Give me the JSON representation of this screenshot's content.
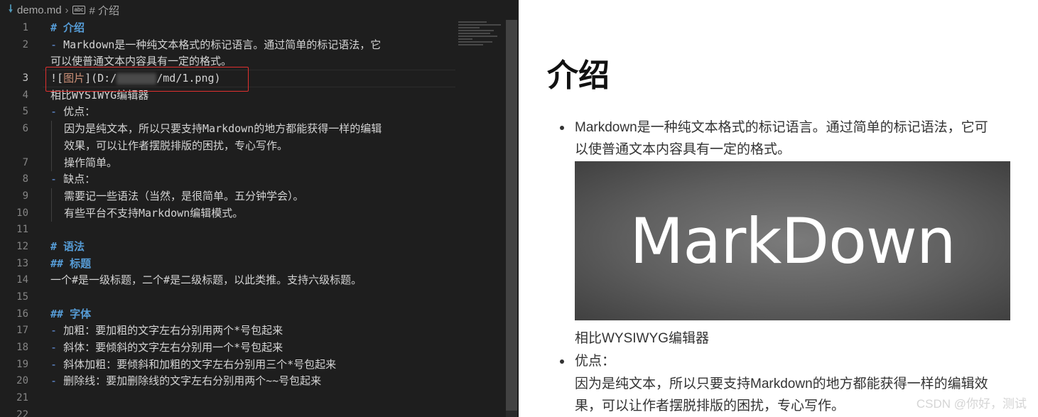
{
  "breadcrumb": {
    "file": "demo.md",
    "symbol": "# 介绍"
  },
  "editor": {
    "lines": [
      {
        "n": "1",
        "parts": [
          {
            "c": "h",
            "t": "# 介绍"
          }
        ]
      },
      {
        "n": "2",
        "parts": [
          {
            "c": "bullet",
            "t": "- "
          },
          {
            "c": "",
            "t": "Markdown是一种纯文本格式的标记语言。通过简单的标记语法，它"
          }
        ]
      },
      {
        "n": "",
        "parts": [
          {
            "c": "",
            "t": "可以使普通文本内容具有一定的格式。"
          }
        ]
      },
      {
        "n": "3",
        "active": true,
        "parts": [
          {
            "c": "img-bang",
            "t": "!["
          },
          {
            "c": "img-alt",
            "t": "图片"
          },
          {
            "c": "img-bang",
            "t": "]("
          },
          {
            "c": "img-url",
            "t": "D:/"
          },
          {
            "c": "blur",
            "t": ""
          },
          {
            "c": "img-url",
            "t": "/md/1.png"
          },
          {
            "c": "img-bang",
            "t": ")"
          }
        ]
      },
      {
        "n": "4",
        "parts": [
          {
            "c": "",
            "t": "相比WYSIWYG编辑器"
          }
        ]
      },
      {
        "n": "5",
        "parts": [
          {
            "c": "bullet",
            "t": "- "
          },
          {
            "c": "",
            "t": "优点："
          }
        ]
      },
      {
        "n": "6",
        "indent": true,
        "parts": [
          {
            "c": "",
            "t": "因为是纯文本，所以只要支持Markdown的地方都能获得一样的编辑"
          }
        ]
      },
      {
        "n": "",
        "indent": true,
        "parts": [
          {
            "c": "",
            "t": "效果，可以让作者摆脱排版的困扰，专心写作。"
          }
        ]
      },
      {
        "n": "7",
        "indent": true,
        "parts": [
          {
            "c": "",
            "t": "操作简单。"
          }
        ]
      },
      {
        "n": "8",
        "parts": [
          {
            "c": "bullet",
            "t": "- "
          },
          {
            "c": "",
            "t": "缺点："
          }
        ]
      },
      {
        "n": "9",
        "indent": true,
        "parts": [
          {
            "c": "",
            "t": "需要记一些语法（当然，是很简单。五分钟学会）。"
          }
        ]
      },
      {
        "n": "10",
        "indent": true,
        "parts": [
          {
            "c": "",
            "t": "有些平台不支持Markdown编辑模式。"
          }
        ]
      },
      {
        "n": "11",
        "parts": []
      },
      {
        "n": "12",
        "parts": [
          {
            "c": "h",
            "t": "# 语法"
          }
        ]
      },
      {
        "n": "13",
        "parts": [
          {
            "c": "h",
            "t": "## 标题"
          }
        ]
      },
      {
        "n": "14",
        "parts": [
          {
            "c": "",
            "t": "一个#是一级标题，二个#是二级标题，以此类推。支持六级标题。"
          }
        ]
      },
      {
        "n": "15",
        "parts": []
      },
      {
        "n": "16",
        "parts": [
          {
            "c": "h",
            "t": "## 字体"
          }
        ]
      },
      {
        "n": "17",
        "parts": [
          {
            "c": "bullet",
            "t": "- "
          },
          {
            "c": "",
            "t": "加粗：要加粗的文字左右分别用两个*号包起来"
          }
        ]
      },
      {
        "n": "18",
        "parts": [
          {
            "c": "bullet",
            "t": "- "
          },
          {
            "c": "",
            "t": "斜体：要倾斜的文字左右分别用一个*号包起来"
          }
        ]
      },
      {
        "n": "19",
        "parts": [
          {
            "c": "bullet",
            "t": "- "
          },
          {
            "c": "",
            "t": "斜体加粗：要倾斜和加粗的文字左右分别用三个*号包起来"
          }
        ]
      },
      {
        "n": "20",
        "parts": [
          {
            "c": "bullet",
            "t": "- "
          },
          {
            "c": "",
            "t": "删除线：要加删除线的文字左右分别用两个~~号包起来"
          }
        ]
      },
      {
        "n": "21",
        "parts": []
      },
      {
        "n": "22",
        "parts": []
      }
    ]
  },
  "preview": {
    "title": "介绍",
    "bullet1_line1": "Markdown是一种纯文本格式的标记语言。通过简单的标记语法，它可",
    "bullet1_line2": "以使普通文本内容具有一定的格式。",
    "image_text": "MarkDown",
    "wysiwyg": "相比WYSIWYG编辑器",
    "bullet2": "优点：",
    "pros_line1": "因为是纯文本，所以只要支持Markdown的地方都能获得一样的编辑效",
    "pros_line2": "果，可以让作者摆脱排版的困扰，专心写作。"
  },
  "watermark": "CSDN @你好，测试"
}
